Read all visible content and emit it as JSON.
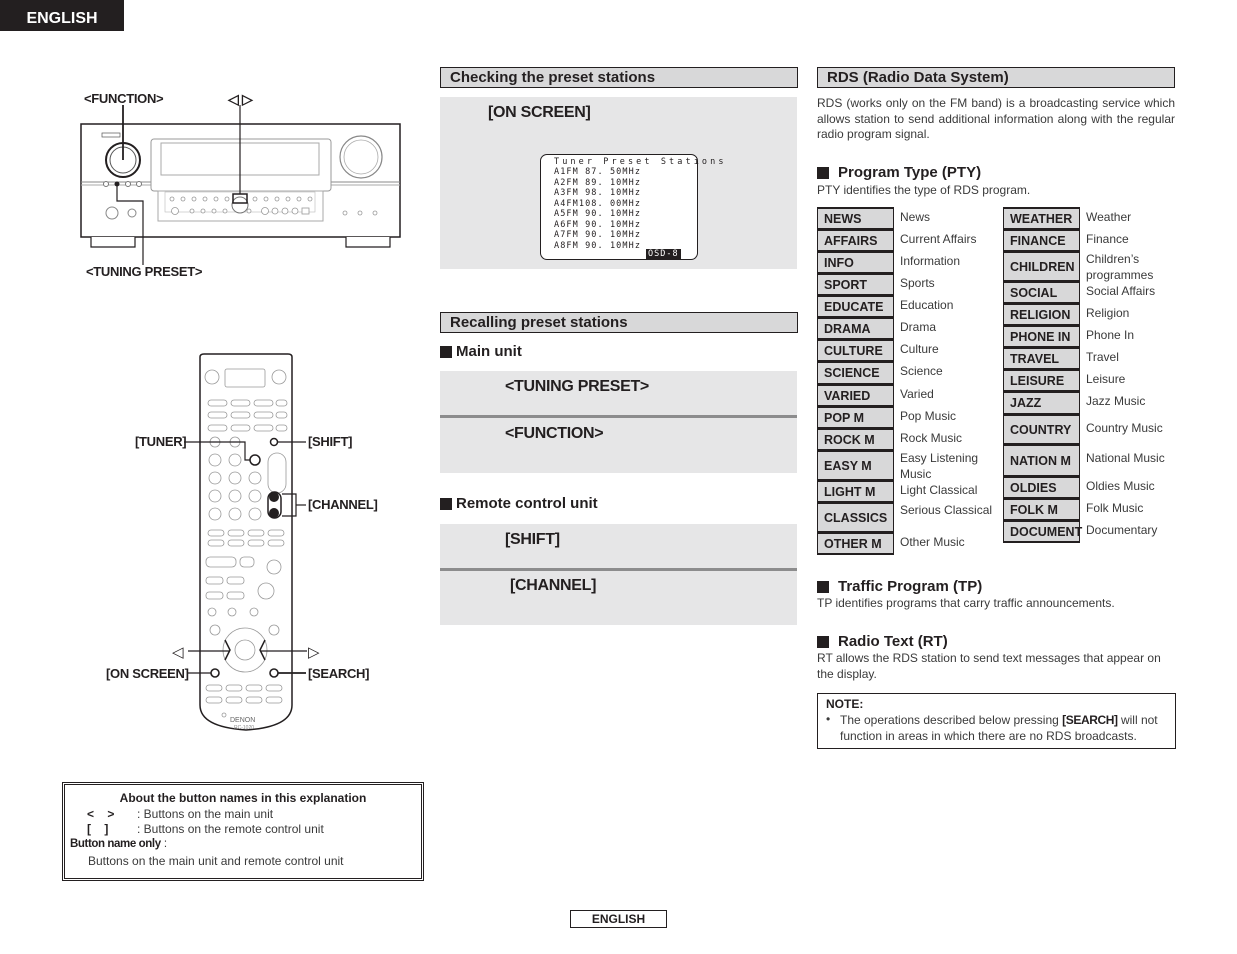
{
  "page": {
    "language_tab": "ENGLISH",
    "footer_language": "ENGLISH"
  },
  "main_unit_diagram": {
    "labels": {
      "function": "<FUNCTION>",
      "cursor_arrows": "◁ ▷",
      "tuning_preset": "<TUNING PRESET>"
    }
  },
  "remote_diagram": {
    "labels": {
      "tuner": "[TUNER]",
      "shift": "[SHIFT]",
      "channel": "[CHANNEL]",
      "left_arrow": "◁",
      "right_arrow": "▷",
      "on_screen": "[ON SCREEN]",
      "search": "[SEARCH]"
    },
    "brand": "DENON",
    "model": "RC-1020"
  },
  "about_box": {
    "title": "About the button names in this explanation",
    "rows": [
      {
        "symbol": "<    >",
        "text": ": Buttons on the main unit"
      },
      {
        "symbol": "[    ]",
        "text": ": Buttons on the remote control unit"
      }
    ],
    "button_name_only_label": "Button name only",
    "button_name_only_colon": " :",
    "button_name_only_text": "Buttons on the main unit and remote control unit"
  },
  "checking": {
    "header": "Checking the preset stations",
    "step_key": "[ON  SCREEN]",
    "osd": {
      "title": "Tuner Preset Stations",
      "lines": [
        "A1FM  87. 50MHz",
        "A2FM  89. 10MHz",
        "A3FM  98. 10MHz",
        "A4FM108. 00MHz",
        "A5FM  90. 10MHz",
        "A6FM  90. 10MHz",
        "A7FM  90. 10MHz",
        "A8FM  90. 10MHz"
      ],
      "badge": "OSD-8"
    }
  },
  "recalling": {
    "header": "Recalling preset stations",
    "main_unit": {
      "title": "Main unit",
      "steps": [
        "<TUNING PRESET>",
        "<FUNCTION>"
      ]
    },
    "remote_unit": {
      "title": "Remote control unit",
      "steps": [
        "[SHIFT]",
        "[CHANNEL]"
      ]
    }
  },
  "rds": {
    "header": "RDS (Radio Data System)",
    "intro": "RDS (works only on the FM band) is a broadcasting service which allows station to send additional information along with the regular radio program signal.",
    "pty": {
      "title": "Program Type (PTY)",
      "description": "PTY identifies the type of RDS program.",
      "left": [
        {
          "code": "NEWS",
          "desc": "News"
        },
        {
          "code": "AFFAIRS",
          "desc": "Current Affairs"
        },
        {
          "code": "INFO",
          "desc": "Information"
        },
        {
          "code": "SPORT",
          "desc": "Sports"
        },
        {
          "code": "EDUCATE",
          "desc": "Education"
        },
        {
          "code": "DRAMA",
          "desc": "Drama"
        },
        {
          "code": "CULTURE",
          "desc": "Culture"
        },
        {
          "code": "SCIENCE",
          "desc": "Science"
        },
        {
          "code": "VARIED",
          "desc": "Varied"
        },
        {
          "code": "POP M",
          "desc": "Pop Music"
        },
        {
          "code": "ROCK M",
          "desc": "Rock Music"
        },
        {
          "code": "EASY M",
          "desc": "Easy Listening Music"
        },
        {
          "code": "LIGHT M",
          "desc": "Light Classical"
        },
        {
          "code": "CLASSICS",
          "desc": "Serious Classical"
        },
        {
          "code": "OTHER M",
          "desc": "Other Music"
        }
      ],
      "right": [
        {
          "code": "WEATHER",
          "desc": "Weather"
        },
        {
          "code": "FINANCE",
          "desc": "Finance"
        },
        {
          "code": "CHILDREN",
          "desc": "Children’s programmes"
        },
        {
          "code": "SOCIAL",
          "desc": "Social Affairs"
        },
        {
          "code": "RELIGION",
          "desc": "Religion"
        },
        {
          "code": "PHONE IN",
          "desc": "Phone In"
        },
        {
          "code": "TRAVEL",
          "desc": "Travel"
        },
        {
          "code": "LEISURE",
          "desc": "Leisure"
        },
        {
          "code": "JAZZ",
          "desc": "Jazz Music"
        },
        {
          "code": "COUNTRY",
          "desc": "Country Music"
        },
        {
          "code": "NATION M",
          "desc": "National Music"
        },
        {
          "code": "OLDIES",
          "desc": "Oldies Music"
        },
        {
          "code": "FOLK M",
          "desc": "Folk Music"
        },
        {
          "code": "DOCUMENT",
          "desc": "Documentary"
        }
      ]
    },
    "tp": {
      "title": "Traffic Program (TP)",
      "description": "TP identifies programs that carry traffic announcements."
    },
    "rt": {
      "title": "Radio Text (RT)",
      "description": "RT allows the RDS station to send text messages that appear on the display."
    },
    "note": {
      "title": "NOTE:",
      "bullet": "•",
      "text_before": "The operations described below pressing ",
      "text_key": "[SEARCH]",
      "text_after": " will not function in areas in which there are no RDS broadcasts."
    }
  }
}
